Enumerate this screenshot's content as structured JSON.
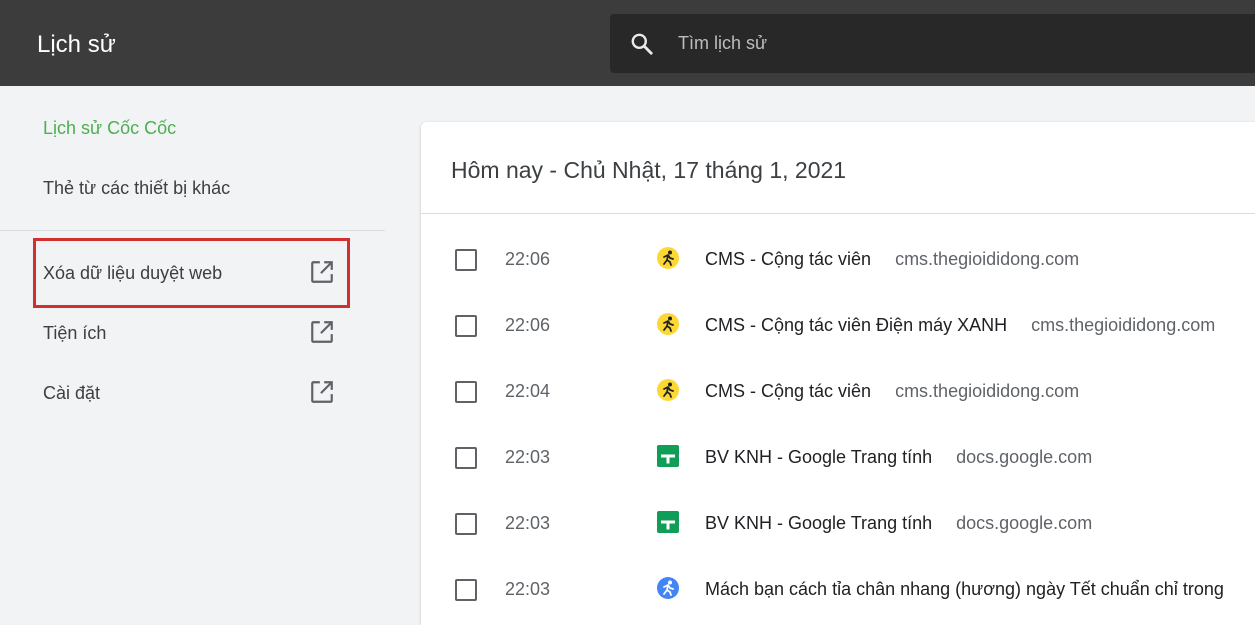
{
  "header": {
    "title": "Lịch sử",
    "search": {
      "placeholder": "Tìm lịch sử",
      "value": ""
    }
  },
  "sidebar": {
    "links": [
      {
        "label": "Lịch sử Cốc Cốc",
        "active": true
      },
      {
        "label": "Thẻ từ các thiết bị khác",
        "active": false
      }
    ],
    "items": [
      {
        "label": "Xóa dữ liệu duyệt web",
        "icon": "open-in-new-icon"
      },
      {
        "label": "Tiện ích",
        "icon": "open-in-new-icon"
      },
      {
        "label": "Cài đặt",
        "icon": "open-in-new-icon"
      }
    ]
  },
  "history": {
    "date_heading": "Hôm nay - Chủ Nhật, 17 tháng 1, 2021",
    "entries": [
      {
        "time": "22:06",
        "title": "CMS - Cộng tác viên",
        "domain": "cms.thegioididong.com",
        "icon": "runner-icon"
      },
      {
        "time": "22:06",
        "title": "CMS - Cộng tác viên Điện máy XANH",
        "domain": "cms.thegioididong.com",
        "icon": "runner-icon"
      },
      {
        "time": "22:04",
        "title": "CMS - Cộng tác viên",
        "domain": "cms.thegioididong.com",
        "icon": "runner-icon"
      },
      {
        "time": "22:03",
        "title": "BV KNH - Google Trang tính",
        "domain": "docs.google.com",
        "icon": "google-sheets-icon"
      },
      {
        "time": "22:03",
        "title": "BV KNH - Google Trang tính",
        "domain": "docs.google.com",
        "icon": "google-sheets-icon"
      },
      {
        "time": "22:03",
        "title": "Mách bạn cách tỉa chân nhang (hương) ngày Tết chuẩn chỉ trong",
        "domain": "",
        "icon": "blue-circle-runner-icon"
      }
    ]
  },
  "colors": {
    "topbar": "#3c3c3c",
    "search_bg": "#282828",
    "accent_green": "#4caf50",
    "highlight_red": "#d32f2f",
    "sheets_green": "#0f9d58",
    "runner_yellow": "#fdd835",
    "runner_blue": "#4285f4"
  }
}
